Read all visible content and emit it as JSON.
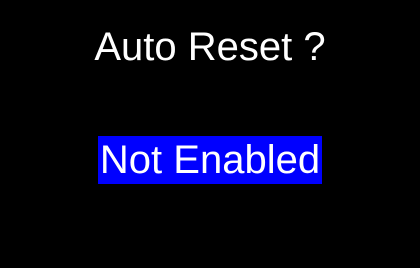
{
  "screen": {
    "title": "Auto Reset ?",
    "selected_option": "Not Enabled",
    "colors": {
      "background": "#000000",
      "text": "#ffffff",
      "highlight": "#0000ff"
    }
  }
}
